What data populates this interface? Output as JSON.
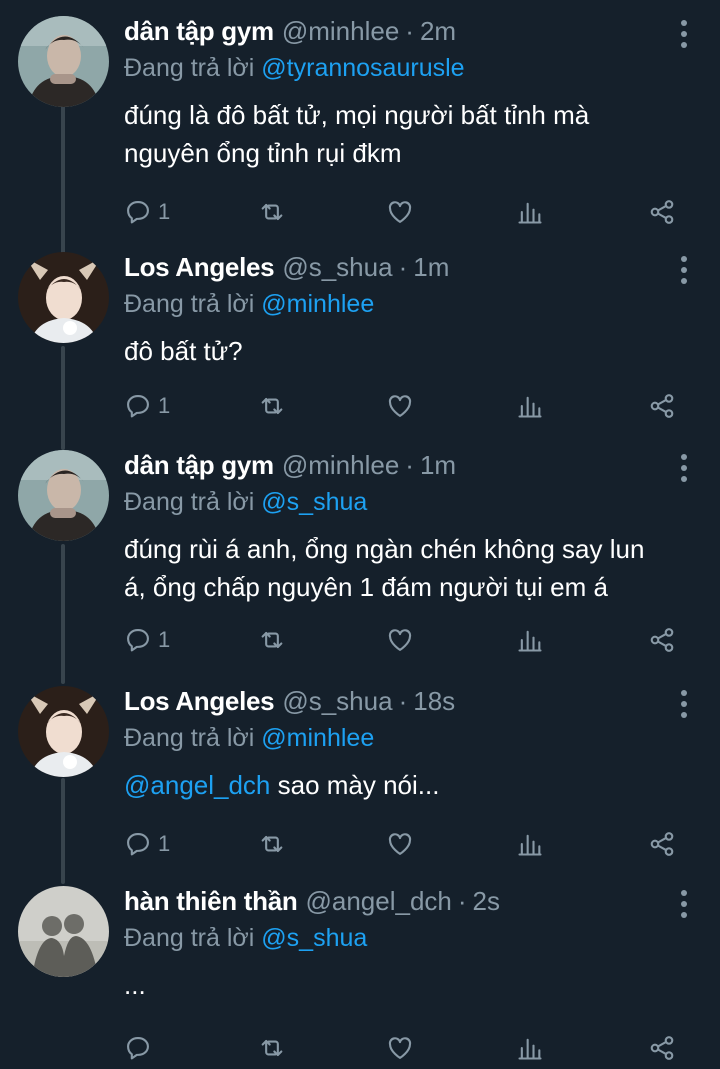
{
  "reply_label": "Đang trả lời",
  "tweets": [
    {
      "display_name": "dân tập gym",
      "handle": "@minhlee",
      "time": "2m",
      "reply_to": "@tyrannosaurusle",
      "text": "đúng là đô bất tử, mọi người bất tỉnh mà nguyên ổng tỉnh rụi đkm",
      "reply_count": "1"
    },
    {
      "display_name": "Los Angeles",
      "handle": "@s_shua",
      "time": "1m",
      "reply_to": "@minhlee",
      "text": "đô bất tử?",
      "reply_count": "1"
    },
    {
      "display_name": "dân tập gym",
      "handle": "@minhlee",
      "time": "1m",
      "reply_to": "@s_shua",
      "text": "đúng rùi á anh, ổng ngàn chén không say lun á, ổng chấp nguyên 1 đám người tụi em á",
      "reply_count": "1"
    },
    {
      "display_name": "Los Angeles",
      "handle": "@s_shua",
      "time": "18s",
      "reply_to": "@minhlee",
      "text_mention": "@angel_dch",
      "text": " sao mày nói...",
      "reply_count": "1"
    },
    {
      "display_name": "hàn thiên thần",
      "handle": "@angel_dch",
      "time": "2s",
      "reply_to": "@s_shua",
      "text": "...",
      "reply_count": ""
    }
  ],
  "icons": [
    "avatar-image",
    "more-options-icon",
    "reply-icon",
    "retweet-icon",
    "like-icon",
    "analytics-icon",
    "share-icon"
  ],
  "colors": {
    "background": "#15202b",
    "mention": "#1da1f2",
    "secondary": "#8899a6",
    "thread_line": "#38444d"
  }
}
